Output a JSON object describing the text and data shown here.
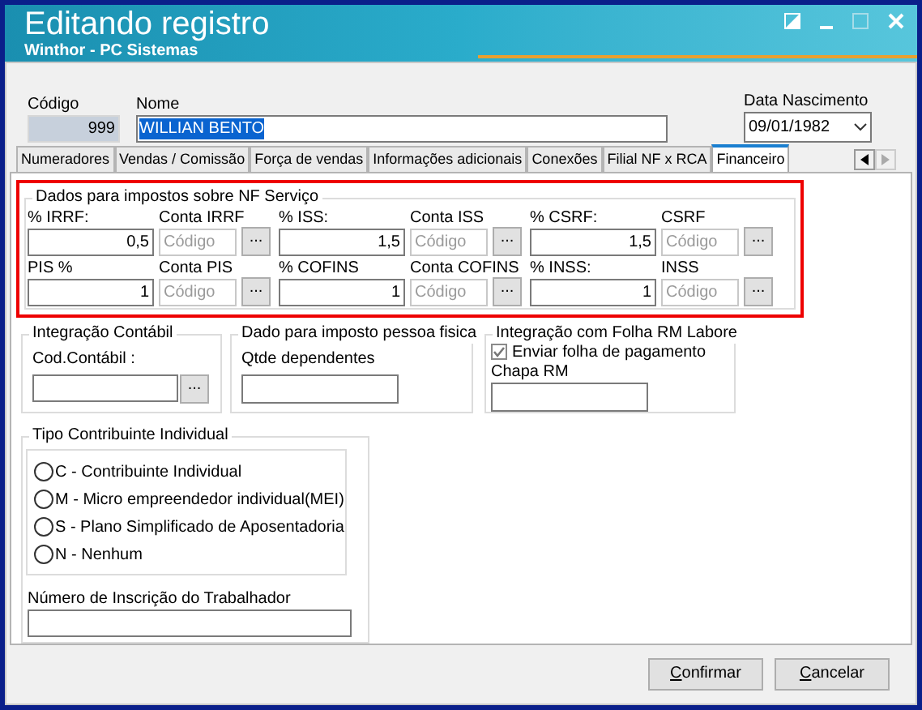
{
  "window": {
    "title": "Editando registro",
    "subtitle": "Winthor - PC Sistemas"
  },
  "header": {
    "codigo": {
      "label": "Código",
      "value": "999"
    },
    "nome": {
      "label": "Nome",
      "value": "WILLIAN BENTO",
      "selected": true
    },
    "data_nascimento": {
      "label": "Data Nascimento",
      "value": "09/01/1982"
    }
  },
  "tabs": [
    {
      "label": "Numeradores",
      "selected": false
    },
    {
      "label": "Vendas  / Comissão",
      "selected": false
    },
    {
      "label": "Força de vendas",
      "selected": false
    },
    {
      "label": "Informações adicionais",
      "selected": false
    },
    {
      "label": "Conexões",
      "selected": false
    },
    {
      "label": "Filial NF x RCA",
      "selected": false
    },
    {
      "label": "Financeiro",
      "selected": true
    }
  ],
  "tax_group": {
    "title": "Dados para impostos sobre NF Serviço",
    "rows": [
      [
        {
          "pct_label": "% IRRF:",
          "pct_value": "0,5",
          "account_label": "Conta IRRF",
          "account_placeholder": "Código",
          "button": "..."
        },
        {
          "pct_label": "% ISS:",
          "pct_value": "1,5",
          "account_label": "Conta ISS",
          "account_placeholder": "Código",
          "button": "..."
        },
        {
          "pct_label": "% CSRF:",
          "pct_value": "1,5",
          "account_label": "CSRF",
          "account_placeholder": "Código",
          "button": "..."
        }
      ],
      [
        {
          "pct_label": "PIS %",
          "pct_value": "1",
          "account_label": "Conta PIS",
          "account_placeholder": "Código",
          "button": "..."
        },
        {
          "pct_label": "% COFINS",
          "pct_value": "1",
          "account_label": "Conta COFINS",
          "account_placeholder": "Código",
          "button": "..."
        },
        {
          "pct_label": "% INSS:",
          "pct_value": "1",
          "account_label": "INSS",
          "account_placeholder": "Código",
          "button": "..."
        }
      ]
    ]
  },
  "integracao_contabil": {
    "title": "Integração Contábil",
    "label": "Cod.Contábil :",
    "button": "..."
  },
  "imposto_pessoa_fisica": {
    "title": "Dado para imposto pessoa fisica",
    "label": "Qtde dependentes"
  },
  "integracao_folha": {
    "title": "Integração com Folha RM Labore",
    "checkbox": {
      "label": "Enviar folha de pagamento",
      "checked": true
    },
    "label": "Chapa RM"
  },
  "tipo_contribuinte": {
    "title": "Tipo Contribuinte Individual",
    "options": [
      {
        "label": "C - Contribuinte Individual",
        "selected": false
      },
      {
        "label": "M - Micro empreendedor individual(MEI)",
        "selected": false
      },
      {
        "label": "S - Plano Simplificado de Aposentadoria",
        "selected": false
      },
      {
        "label": "N - Nenhum",
        "selected": false
      }
    ],
    "inscricao_label": "Número de Inscrição do Trabalhador"
  },
  "buttons": [
    "Confirmar",
    "Cancelar"
  ]
}
